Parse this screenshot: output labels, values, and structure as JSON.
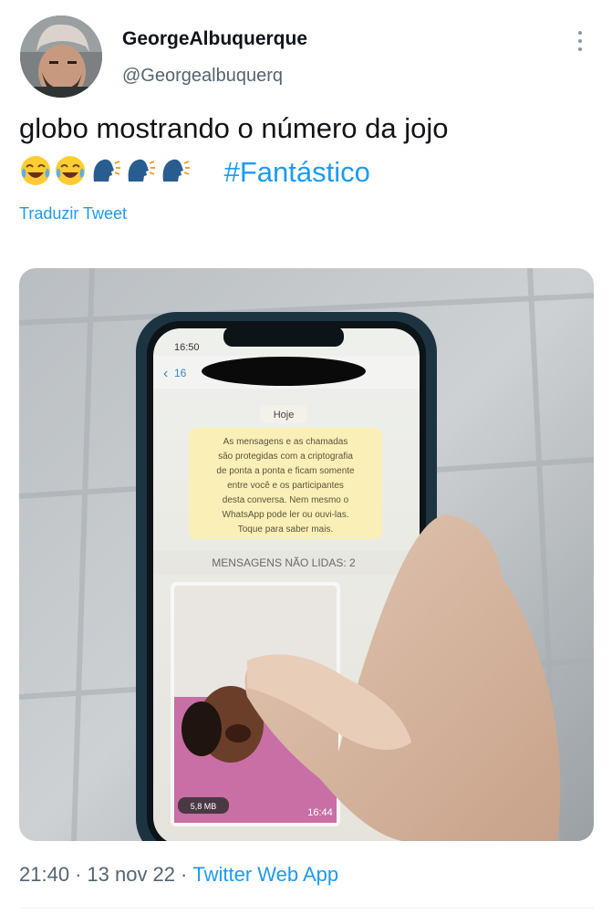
{
  "author": {
    "display_name": "GeorgeAlbuquerque",
    "handle": "@Georgealbuquerq"
  },
  "tweet": {
    "text": "globo  mostrando o número da  jojo",
    "emojis": [
      "face-with-tears-of-joy",
      "face-with-tears-of-joy",
      "speaking-head",
      "speaking-head",
      "speaking-head"
    ],
    "hashtag": "#Fantástico",
    "translate_label": "Traduzir Tweet"
  },
  "media": {
    "phone": {
      "status_time": "16:50",
      "back_label": "16",
      "date_label": "Hoje",
      "encryption_notice": [
        "As mensagens e as chamadas",
        "são protegidas com a criptografia",
        "de ponta a ponta e ficam somente",
        "entre você e os participantes",
        "desta conversa. Nem mesmo o",
        "WhatsApp pode ler ou ouvi-las.",
        "Toque para saber mais."
      ],
      "unread_label": "MENSAGENS NÃO LIDAS: 2",
      "video_size": "5,8 MB",
      "video_time": "16:44"
    }
  },
  "meta": {
    "time": "21:40",
    "separator": "·",
    "date": "13 nov 22",
    "source": "Twitter Web App"
  },
  "colors": {
    "link": "#1d9bf0",
    "secondary_text": "#536471",
    "primary_text": "#0f1419"
  }
}
